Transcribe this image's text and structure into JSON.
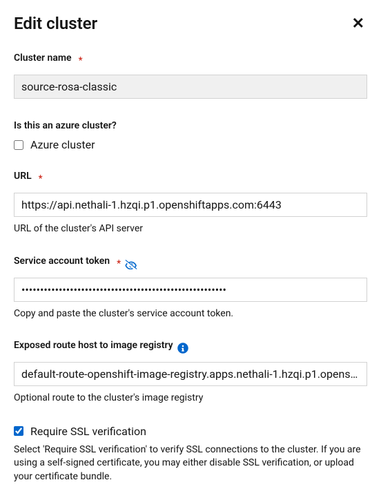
{
  "header": {
    "title": "Edit cluster"
  },
  "clusterName": {
    "label": "Cluster name",
    "value": "source-rosa-classic"
  },
  "azure": {
    "question": "Is this an azure cluster?",
    "checkboxLabel": "Azure cluster"
  },
  "url": {
    "label": "URL",
    "value": "https://api.nethali-1.hzqi.p1.openshiftapps.com:6443",
    "helper": "URL of the cluster's API server"
  },
  "token": {
    "label": "Service account token",
    "value": "•••••••••••••••••••••••••••••••••••••••••••••••••••••••",
    "helper": "Copy and paste the cluster's service account token."
  },
  "exposedRoute": {
    "label": "Exposed route host to image registry",
    "value": "default-route-openshift-image-registry.apps.nethali-1.hzqi.p1.opens…",
    "helper": "Optional route to the cluster's image registry"
  },
  "ssl": {
    "checkboxLabel": "Require SSL verification",
    "helper": "Select 'Require SSL verification' to verify SSL connections to the cluster. If you are using a self-signed certificate, you may either disable SSL verification, or upload your certificate bundle."
  }
}
